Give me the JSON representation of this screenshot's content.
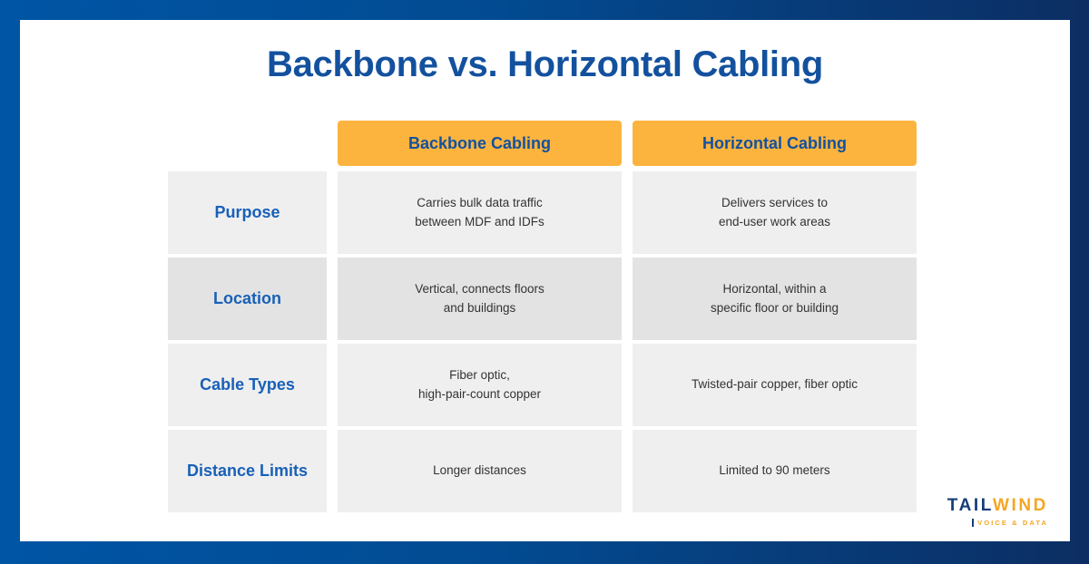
{
  "slide": {
    "title": "Backbone vs. Horizontal Cabling",
    "frame_color_left": "#0055A5",
    "frame_color_right": "#0C2E63",
    "background": "#FFFFFF"
  },
  "table": {
    "corner_label": "",
    "header_accent": "#FCB43F",
    "label_color": "#1860B8",
    "columns": [
      {
        "label": "Backbone Cabling"
      },
      {
        "label": "Horizontal Cabling"
      }
    ],
    "rows": [
      {
        "label": "Purpose",
        "backbone": "Carries bulk data traffic\nbetween MDF and IDFs",
        "horizontal": "Delivers services to\nend-user work areas"
      },
      {
        "label": "Location",
        "backbone": "Vertical, connects floors\nand buildings",
        "horizontal": "Horizontal, within a\nspecific floor or building"
      },
      {
        "label": "Cable Types",
        "backbone": "Fiber optic,\nhigh-pair-count copper",
        "horizontal": "Twisted-pair copper, fiber optic"
      },
      {
        "label": "Distance Limits",
        "backbone": "Longer distances",
        "horizontal": "Limited to 90 meters"
      }
    ]
  },
  "logo": {
    "word_part_one": "TAIL",
    "word_part_two": "WIND",
    "tagline": "VOICE & DATA",
    "color_primary": "#143E77",
    "color_accent": "#F5A623"
  }
}
